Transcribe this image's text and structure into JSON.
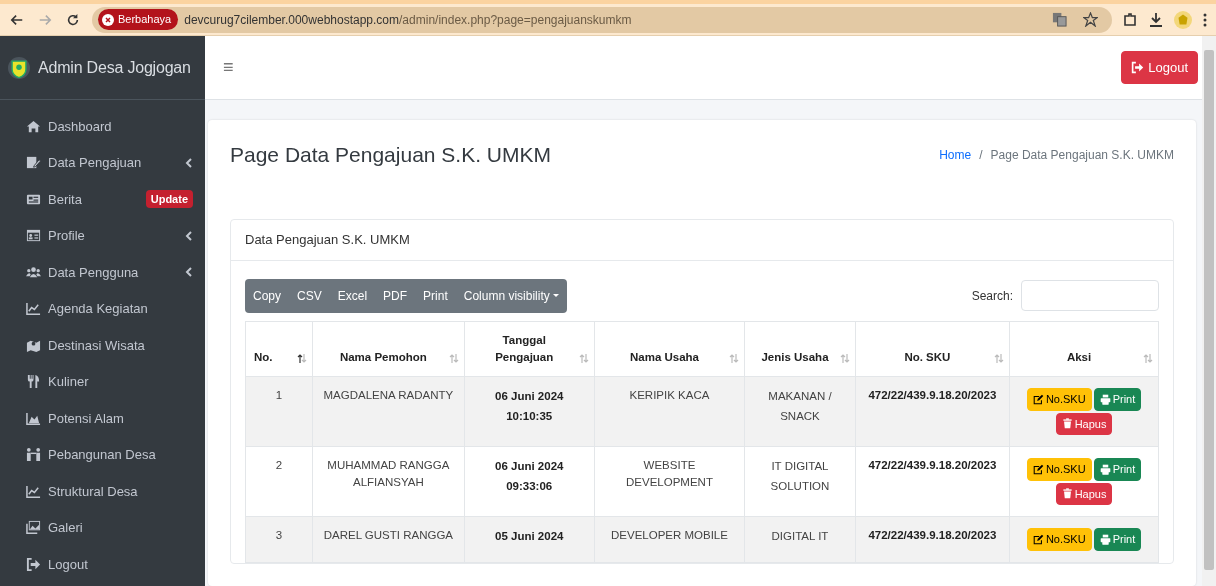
{
  "browser": {
    "security_badge": "Berbahaya",
    "url": {
      "host": "devcurug7cilember.000webhostapp.com",
      "path": "/admin/index.php?page=pengajuanskumkm"
    },
    "forward_disabled": true
  },
  "sidebar": {
    "brand": "Admin Desa Jogjogan",
    "items": [
      {
        "label": "Dashboard",
        "has_children": false
      },
      {
        "label": "Data Pengajuan",
        "has_children": true
      },
      {
        "label": "Berita",
        "has_children": false,
        "badge": "Update"
      },
      {
        "label": "Profile",
        "has_children": true
      },
      {
        "label": "Data Pengguna",
        "has_children": true
      },
      {
        "label": "Agenda Kegiatan",
        "has_children": false
      },
      {
        "label": "Destinasi Wisata",
        "has_children": false
      },
      {
        "label": "Kuliner",
        "has_children": false
      },
      {
        "label": "Potensi Alam",
        "has_children": false
      },
      {
        "label": "Pebangunan Desa",
        "has_children": false
      },
      {
        "label": "Struktural Desa",
        "has_children": false
      },
      {
        "label": "Galeri",
        "has_children": false
      },
      {
        "label": "Logout",
        "has_children": false
      }
    ]
  },
  "topbar": {
    "menu_toggle": "≡",
    "logout_button": "Logout"
  },
  "page": {
    "title": "Page Data Pengajuan S.K. UMKM",
    "breadcrumb": [
      {
        "label": "Home",
        "kind": "link"
      },
      {
        "label": "/",
        "kind": "separator"
      },
      {
        "label": "Page Data Pengajuan S.K. UMKM",
        "kind": "current"
      }
    ]
  },
  "card": {
    "title": "Data Pengajuan S.K. UMKM",
    "export_buttons": [
      "Copy",
      "CSV",
      "Excel",
      "PDF",
      "Print"
    ],
    "column_visibility": "Column visibility",
    "search": {
      "label": "Search:"
    },
    "table": {
      "columns": [
        {
          "label": "No.",
          "sorted": true
        },
        {
          "label": "Nama Pemohon",
          "sorted": false
        },
        {
          "label": "Tanggal Pengajuan",
          "sorted": false
        },
        {
          "label": "Nama Usaha",
          "sorted": false
        },
        {
          "label": "Jenis Usaha",
          "sorted": false
        },
        {
          "label": "No. SKU",
          "sorted": false
        },
        {
          "label": "Aksi",
          "sorted": false
        }
      ],
      "rows": [
        {
          "no": "1",
          "nama_pemohon": "MAGDALENA RADANTY",
          "tanggal": "06 Juni 2024",
          "jam": "10:10:35",
          "nama_usaha": "KERIPIK KACA",
          "jenis_usaha": "MAKANAN / SNACK",
          "no_sku": "472/22/439.9.18.20/2023",
          "actions": [
            {
              "label": "No.SKU",
              "kind": "edit"
            },
            {
              "label": "Print",
              "kind": "print"
            },
            {
              "label": "Hapus",
              "kind": "delete"
            }
          ]
        },
        {
          "no": "2",
          "nama_pemohon": "MUHAMMAD RANGGA ALFIANSYAH",
          "tanggal": "06 Juni 2024",
          "jam": "09:33:06",
          "nama_usaha": "WEBSITE DEVELOPMENT",
          "jenis_usaha": "IT DIGITAL SOLUTION",
          "no_sku": "472/22/439.9.18.20/2023",
          "actions": [
            {
              "label": "No.SKU",
              "kind": "edit"
            },
            {
              "label": "Print",
              "kind": "print"
            },
            {
              "label": "Hapus",
              "kind": "delete"
            }
          ]
        },
        {
          "no": "3",
          "nama_pemohon": "DAREL GUSTI RANGGA",
          "tanggal": "05 Juni 2024",
          "nama_usaha": "DEVELOPER MOBILE",
          "jenis_usaha": "DIGITAL IT",
          "no_sku": "472/22/439.9.18.20/2023",
          "actions": [
            {
              "label": "No.SKU",
              "kind": "edit"
            },
            {
              "label": "Print",
              "kind": "print"
            }
          ]
        }
      ]
    }
  }
}
